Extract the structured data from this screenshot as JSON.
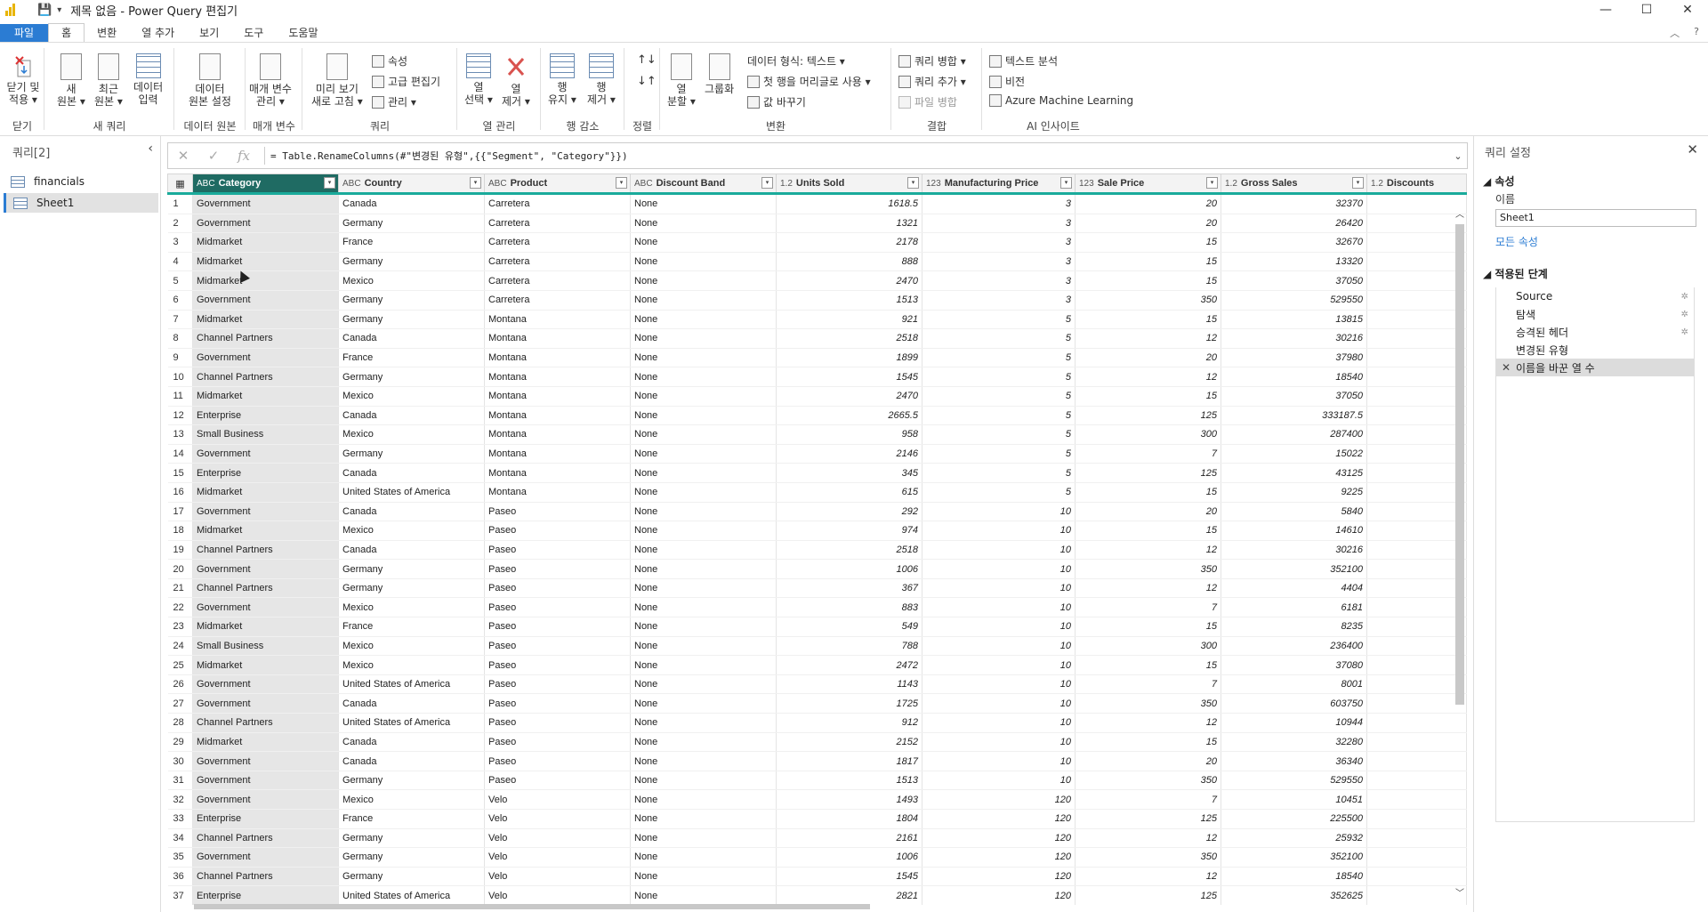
{
  "window": {
    "title": "제목 없음 - Power Query 편집기",
    "minimize": "—",
    "maximize": "☐",
    "close": "✕"
  },
  "menu_tabs": [
    "파일",
    "홈",
    "변환",
    "열 추가",
    "보기",
    "도구",
    "도움말"
  ],
  "ribbon": {
    "close": {
      "btn": "닫기 및\n적용 ▾",
      "group": "닫기"
    },
    "newquery": {
      "new_src": "새\n원본 ▾",
      "recent_src": "최근\n원본 ▾",
      "enter_data": "데이터\n입력",
      "group": "새 쿼리"
    },
    "datasource": {
      "btn": "데이터\n원본 설정",
      "group": "데이터 원본"
    },
    "params": {
      "btn": "매개 변수\n관리 ▾",
      "group": "매개 변수"
    },
    "query": {
      "refresh": "미리 보기\n새로 고침 ▾",
      "props": "속성",
      "advanced": "고급 편집기",
      "manage": "관리 ▾",
      "group": "쿼리"
    },
    "columns": {
      "choose": "열\n선택 ▾",
      "remove": "열\n제거 ▾",
      "group": "열 관리"
    },
    "rows": {
      "keep": "행\n유지 ▾",
      "remove": "행\n제거 ▾",
      "group": "행 감소"
    },
    "sort": {
      "group": "정렬"
    },
    "transform": {
      "split": "열\n분할 ▾",
      "groupby": "그룹화",
      "datatype": "데이터 형식: 텍스트 ▾",
      "header": "첫 행을 머리글로 사용 ▾",
      "replace": "값 바꾸기",
      "group": "변환"
    },
    "combine": {
      "merge": "쿼리 병합 ▾",
      "append": "쿼리 추가 ▾",
      "files": "파일 병합",
      "group": "결합"
    },
    "ai": {
      "text": "텍스트 분석",
      "vision": "비전",
      "azure": "Azure Machine Learning",
      "group": "AI 인사이트"
    }
  },
  "queries_panel": {
    "title": "쿼리[2]",
    "items": [
      "financials",
      "Sheet1"
    ],
    "selected": "Sheet1"
  },
  "formula_bar": {
    "cancel": "✕",
    "confirm": "✓",
    "fx": "fx",
    "formula": "= Table.RenameColumns(#\"변경된 유형\",{{\"Segment\", \"Category\"}})"
  },
  "grid": {
    "columns": [
      {
        "type": "ABC",
        "name": "Category"
      },
      {
        "type": "ABC",
        "name": "Country"
      },
      {
        "type": "ABC",
        "name": "Product"
      },
      {
        "type": "ABC",
        "name": "Discount Band"
      },
      {
        "type": "1.2",
        "name": "Units Sold"
      },
      {
        "type": "123",
        "name": "Manufacturing Price"
      },
      {
        "type": "123",
        "name": "Sale Price"
      },
      {
        "type": "1.2",
        "name": "Gross Sales"
      },
      {
        "type": "1.2",
        "name": "Discounts"
      }
    ],
    "rows": [
      [
        "Government",
        "Canada",
        "Carretera",
        "None",
        "1618.5",
        "3",
        "20",
        "32370"
      ],
      [
        "Government",
        "Germany",
        "Carretera",
        "None",
        "1321",
        "3",
        "20",
        "26420"
      ],
      [
        "Midmarket",
        "France",
        "Carretera",
        "None",
        "2178",
        "3",
        "15",
        "32670"
      ],
      [
        "Midmarket",
        "Germany",
        "Carretera",
        "None",
        "888",
        "3",
        "15",
        "13320"
      ],
      [
        "Midmarket",
        "Mexico",
        "Carretera",
        "None",
        "2470",
        "3",
        "15",
        "37050"
      ],
      [
        "Government",
        "Germany",
        "Carretera",
        "None",
        "1513",
        "3",
        "350",
        "529550"
      ],
      [
        "Midmarket",
        "Germany",
        "Montana",
        "None",
        "921",
        "5",
        "15",
        "13815"
      ],
      [
        "Channel Partners",
        "Canada",
        "Montana",
        "None",
        "2518",
        "5",
        "12",
        "30216"
      ],
      [
        "Government",
        "France",
        "Montana",
        "None",
        "1899",
        "5",
        "20",
        "37980"
      ],
      [
        "Channel Partners",
        "Germany",
        "Montana",
        "None",
        "1545",
        "5",
        "12",
        "18540"
      ],
      [
        "Midmarket",
        "Mexico",
        "Montana",
        "None",
        "2470",
        "5",
        "15",
        "37050"
      ],
      [
        "Enterprise",
        "Canada",
        "Montana",
        "None",
        "2665.5",
        "5",
        "125",
        "333187.5"
      ],
      [
        "Small Business",
        "Mexico",
        "Montana",
        "None",
        "958",
        "5",
        "300",
        "287400"
      ],
      [
        "Government",
        "Germany",
        "Montana",
        "None",
        "2146",
        "5",
        "7",
        "15022"
      ],
      [
        "Enterprise",
        "Canada",
        "Montana",
        "None",
        "345",
        "5",
        "125",
        "43125"
      ],
      [
        "Midmarket",
        "United States of America",
        "Montana",
        "None",
        "615",
        "5",
        "15",
        "9225"
      ],
      [
        "Government",
        "Canada",
        "Paseo",
        "None",
        "292",
        "10",
        "20",
        "5840"
      ],
      [
        "Midmarket",
        "Mexico",
        "Paseo",
        "None",
        "974",
        "10",
        "15",
        "14610"
      ],
      [
        "Channel Partners",
        "Canada",
        "Paseo",
        "None",
        "2518",
        "10",
        "12",
        "30216"
      ],
      [
        "Government",
        "Germany",
        "Paseo",
        "None",
        "1006",
        "10",
        "350",
        "352100"
      ],
      [
        "Channel Partners",
        "Germany",
        "Paseo",
        "None",
        "367",
        "10",
        "12",
        "4404"
      ],
      [
        "Government",
        "Mexico",
        "Paseo",
        "None",
        "883",
        "10",
        "7",
        "6181"
      ],
      [
        "Midmarket",
        "France",
        "Paseo",
        "None",
        "549",
        "10",
        "15",
        "8235"
      ],
      [
        "Small Business",
        "Mexico",
        "Paseo",
        "None",
        "788",
        "10",
        "300",
        "236400"
      ],
      [
        "Midmarket",
        "Mexico",
        "Paseo",
        "None",
        "2472",
        "10",
        "15",
        "37080"
      ],
      [
        "Government",
        "United States of America",
        "Paseo",
        "None",
        "1143",
        "10",
        "7",
        "8001"
      ],
      [
        "Government",
        "Canada",
        "Paseo",
        "None",
        "1725",
        "10",
        "350",
        "603750"
      ],
      [
        "Channel Partners",
        "United States of America",
        "Paseo",
        "None",
        "912",
        "10",
        "12",
        "10944"
      ],
      [
        "Midmarket",
        "Canada",
        "Paseo",
        "None",
        "2152",
        "10",
        "15",
        "32280"
      ],
      [
        "Government",
        "Canada",
        "Paseo",
        "None",
        "1817",
        "10",
        "20",
        "36340"
      ],
      [
        "Government",
        "Germany",
        "Paseo",
        "None",
        "1513",
        "10",
        "350",
        "529550"
      ],
      [
        "Government",
        "Mexico",
        "Velo",
        "None",
        "1493",
        "120",
        "7",
        "10451"
      ],
      [
        "Enterprise",
        "France",
        "Velo",
        "None",
        "1804",
        "120",
        "125",
        "225500"
      ],
      [
        "Channel Partners",
        "Germany",
        "Velo",
        "None",
        "2161",
        "120",
        "12",
        "25932"
      ],
      [
        "Government",
        "Germany",
        "Velo",
        "None",
        "1006",
        "120",
        "350",
        "352100"
      ],
      [
        "Channel Partners",
        "Germany",
        "Velo",
        "None",
        "1545",
        "120",
        "12",
        "18540"
      ],
      [
        "Enterprise",
        "United States of America",
        "Velo",
        "None",
        "2821",
        "120",
        "125",
        "352625"
      ]
    ]
  },
  "settings_panel": {
    "title": "쿼리 설정",
    "props_section": "◢ 속성",
    "name_label": "이름",
    "name_value": "Sheet1",
    "all_props": "모든 속성",
    "steps_section": "◢ 적용된 단계",
    "steps": [
      "Source",
      "탐색",
      "승격된 헤더",
      "변경된 유형",
      "이름을 바꾼 열 수"
    ],
    "selected_step": "이름을 바꾼 열 수"
  }
}
